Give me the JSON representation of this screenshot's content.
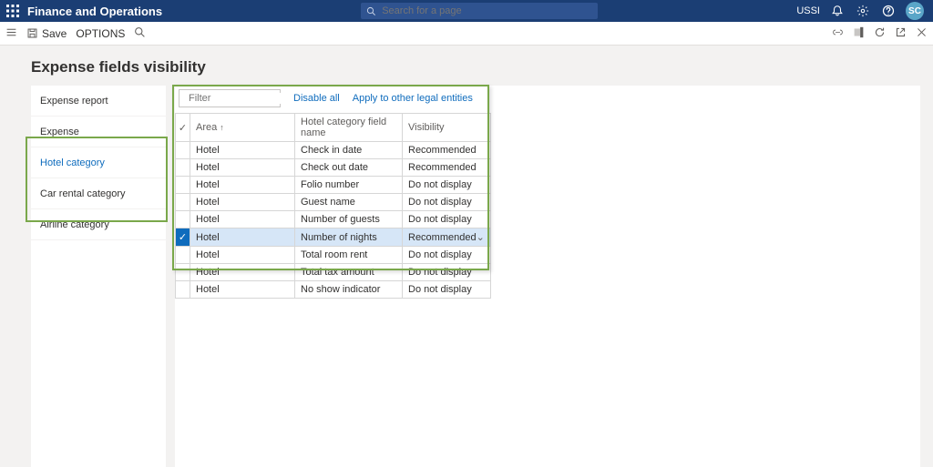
{
  "topbar": {
    "app_title": "Finance and Operations",
    "search_placeholder": "Search for a page",
    "company": "USSI",
    "avatar_initials": "SC"
  },
  "actionbar": {
    "save_label": "Save",
    "options_label": "OPTIONS"
  },
  "page": {
    "title": "Expense fields visibility"
  },
  "sidenav": {
    "items": [
      {
        "label": "Expense report"
      },
      {
        "label": "Expense"
      },
      {
        "label": "Hotel category",
        "active": true
      },
      {
        "label": "Car rental category"
      },
      {
        "label": "Airline category"
      }
    ]
  },
  "toolbar": {
    "filter_placeholder": "Filter",
    "disable_all_label": "Disable all",
    "apply_label": "Apply to other legal entities"
  },
  "grid": {
    "headers": {
      "area": "Area",
      "field": "Hotel category field name",
      "visibility": "Visibility"
    },
    "rows": [
      {
        "area": "Hotel",
        "field": "Check in date",
        "visibility": "Recommended",
        "selected": false
      },
      {
        "area": "Hotel",
        "field": "Check out date",
        "visibility": "Recommended",
        "selected": false
      },
      {
        "area": "Hotel",
        "field": "Folio number",
        "visibility": "Do not display",
        "selected": false
      },
      {
        "area": "Hotel",
        "field": "Guest name",
        "visibility": "Do not display",
        "selected": false
      },
      {
        "area": "Hotel",
        "field": "Number of guests",
        "visibility": "Do not display",
        "selected": false
      },
      {
        "area": "Hotel",
        "field": "Number of nights",
        "visibility": "Recommended",
        "selected": true
      },
      {
        "area": "Hotel",
        "field": "Total room rent",
        "visibility": "Do not display",
        "selected": false
      },
      {
        "area": "Hotel",
        "field": "Total tax amount",
        "visibility": "Do not display",
        "selected": false
      },
      {
        "area": "Hotel",
        "field": "No show indicator",
        "visibility": "Do not display",
        "selected": false
      }
    ]
  }
}
